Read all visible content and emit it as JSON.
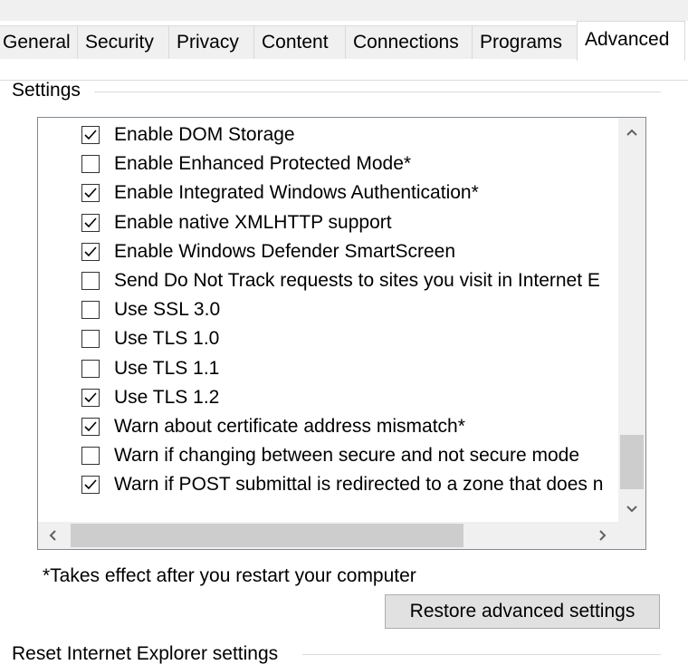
{
  "tabs": [
    {
      "label": "General",
      "active": false
    },
    {
      "label": "Security",
      "active": false
    },
    {
      "label": "Privacy",
      "active": false
    },
    {
      "label": "Content",
      "active": false
    },
    {
      "label": "Connections",
      "active": false
    },
    {
      "label": "Programs",
      "active": false
    },
    {
      "label": "Advanced",
      "active": true
    }
  ],
  "settings_group": {
    "label": "Settings",
    "items": [
      {
        "label": "Enable DOM Storage",
        "checked": true
      },
      {
        "label": "Enable Enhanced Protected Mode*",
        "checked": false
      },
      {
        "label": "Enable Integrated Windows Authentication*",
        "checked": true
      },
      {
        "label": "Enable native XMLHTTP support",
        "checked": true
      },
      {
        "label": "Enable Windows Defender SmartScreen",
        "checked": true
      },
      {
        "label": "Send Do Not Track requests to sites you visit in Internet E",
        "checked": false
      },
      {
        "label": "Use SSL 3.0",
        "checked": false
      },
      {
        "label": "Use TLS 1.0",
        "checked": false
      },
      {
        "label": "Use TLS 1.1",
        "checked": false
      },
      {
        "label": "Use TLS 1.2",
        "checked": true
      },
      {
        "label": "Warn about certificate address mismatch*",
        "checked": true
      },
      {
        "label": "Warn if changing between secure and not secure mode",
        "checked": false
      },
      {
        "label": "Warn if POST submittal is redirected to a zone that does n",
        "checked": true
      }
    ]
  },
  "note": "*Takes effect after you restart your computer",
  "restore_button": "Restore advanced settings",
  "reset_group_label": "Reset Internet Explorer settings",
  "colors": {
    "accent": "#000000",
    "window_bg": "#ffffff",
    "button_bg": "#e1e1e1"
  }
}
